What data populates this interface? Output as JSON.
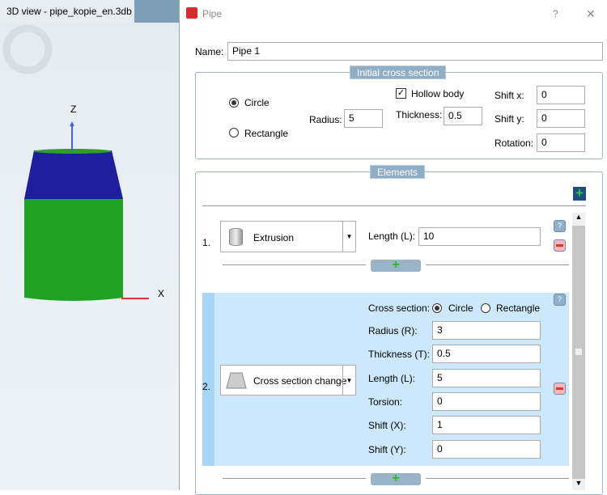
{
  "view": {
    "tab_title": "3D view - pipe_kopie_en.3db",
    "axis_z": "Z",
    "axis_x": "X"
  },
  "dialog": {
    "title": "Pipe",
    "help": "?",
    "close": "✕",
    "name_label": "Name:",
    "name_value": "Pipe 1",
    "initial": {
      "legend": "Initial cross section",
      "circle": "Circle",
      "rectangle": "Rectangle",
      "selected": "Circle",
      "radius_label": "Radius:",
      "radius": "5",
      "hollow_label": "Hollow body",
      "hollow_checked": true,
      "thickness_label": "Thickness:",
      "thickness": "0.5",
      "shiftx_label": "Shift x:",
      "shiftx": "0",
      "shifty_label": "Shift y:",
      "shifty": "0",
      "rotation_label": "Rotation:",
      "rotation": "0"
    },
    "elements": {
      "legend": "Elements",
      "e1": {
        "num": "1.",
        "type": "Extrusion",
        "length_label": "Length (L):",
        "length": "10"
      },
      "e2": {
        "num": "2.",
        "type": "Cross section change",
        "cs_label": "Cross section:",
        "circle": "Circle",
        "rectangle": "Rectangle",
        "radius_label": "Radius (R):",
        "radius": "3",
        "thickness_label": "Thickness (T):",
        "thickness": "0.5",
        "length_label": "Length (L):",
        "length": "5",
        "torsion_label": "Torsion:",
        "torsion": "0",
        "shiftx_label": "Shift (X):",
        "shiftx": "1",
        "shifty_label": "Shift (Y):",
        "shifty": "0"
      }
    }
  },
  "colors": {
    "top": "#1e1e9e",
    "body": "#1e9e2a",
    "accent": "#8fadc4",
    "highlight": "#cce8fa"
  }
}
